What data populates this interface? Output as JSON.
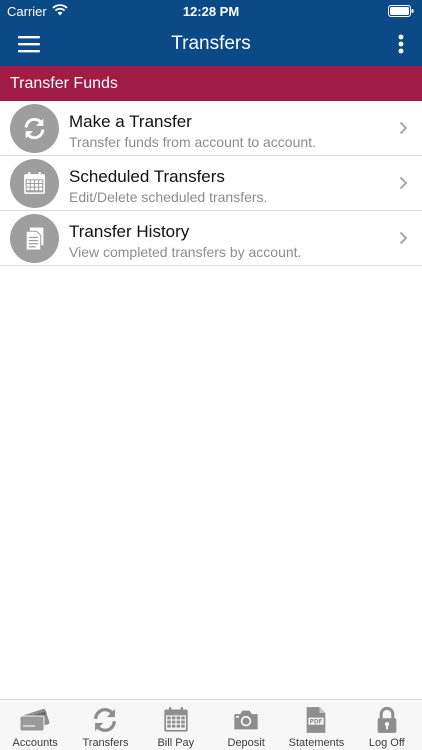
{
  "status_bar": {
    "carrier": "Carrier",
    "time": "12:28 PM"
  },
  "nav": {
    "title": "Transfers"
  },
  "section": {
    "title": "Transfer Funds"
  },
  "items": [
    {
      "title": "Make a Transfer",
      "subtitle": "Transfer funds from account to account.",
      "icon": "sync-arrows-icon"
    },
    {
      "title": "Scheduled Transfers",
      "subtitle": "Edit/Delete scheduled transfers.",
      "icon": "calendar-icon"
    },
    {
      "title": "Transfer History",
      "subtitle": "View completed transfers by account.",
      "icon": "document-icon"
    }
  ],
  "tabs": [
    {
      "label": "Accounts",
      "icon": "credit-cards-icon"
    },
    {
      "label": "Transfers",
      "icon": "sync-arrows-icon"
    },
    {
      "label": "Bill Pay",
      "icon": "calendar-icon"
    },
    {
      "label": "Deposit",
      "icon": "camera-icon"
    },
    {
      "label": "Statements",
      "icon": "pdf-icon"
    },
    {
      "label": "Log Off",
      "icon": "lock-icon"
    }
  ],
  "colors": {
    "nav_bg": "#0b4a86",
    "section_bg": "#a01b47",
    "icon_circle": "#9e9e9e",
    "tab_icon": "#8e8e8e"
  }
}
